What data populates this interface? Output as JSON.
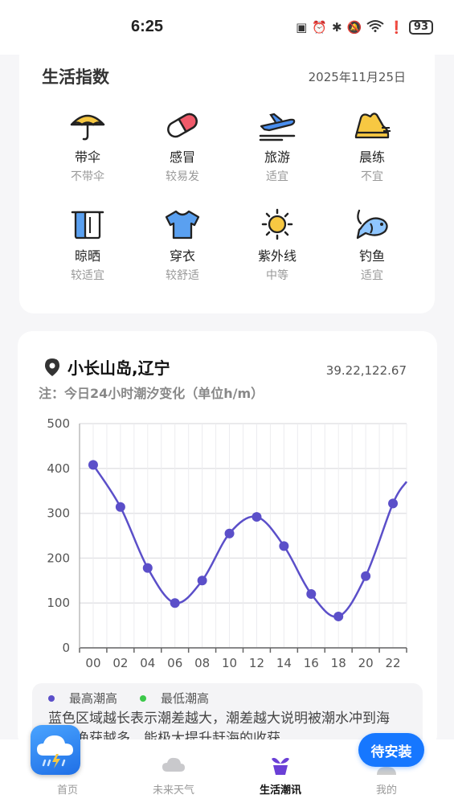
{
  "status_bar": {
    "time": "6:25",
    "battery": "93",
    "icons": [
      "nfc-icon",
      "alarm-icon",
      "bluetooth-icon",
      "mute-icon",
      "wifi-icon",
      "alert-icon",
      "battery-icon"
    ]
  },
  "life_index": {
    "title": "生活指数",
    "date": "2025年11月25日",
    "items": [
      {
        "icon": "umbrella-icon",
        "name": "带伞",
        "value": "不带伞"
      },
      {
        "icon": "pill-icon",
        "name": "感冒",
        "value": "较易发"
      },
      {
        "icon": "airplane-icon",
        "name": "旅游",
        "value": "适宜"
      },
      {
        "icon": "shoe-icon",
        "name": "晨练",
        "value": "不宜"
      },
      {
        "icon": "towel-icon",
        "name": "晾晒",
        "value": "较适宜"
      },
      {
        "icon": "tshirt-icon",
        "name": "穿衣",
        "value": "较舒适"
      },
      {
        "icon": "sun-icon",
        "name": "紫外线",
        "value": "中等"
      },
      {
        "icon": "fish-icon",
        "name": "钓鱼",
        "value": "适宜"
      }
    ]
  },
  "tide": {
    "location": "小长山岛,辽宁",
    "coords": "39.22,122.67",
    "note": "注：今日24小时潮汐变化（单位h/m）",
    "legend": [
      {
        "label": "最高潮高",
        "color": "#5b4fc9"
      },
      {
        "label": "最低潮高",
        "color": "#3cc84a"
      }
    ],
    "description": "蓝色区域越长表示潮差越大，潮差越大说明被潮水冲到海岸的渔获越多，能极大提升赶海的收获"
  },
  "chart_data": {
    "type": "line",
    "x": [
      1,
      3,
      5,
      7,
      9,
      11,
      13,
      15,
      17,
      19,
      21,
      23
    ],
    "x_ticks": [
      "00",
      "02",
      "04",
      "06",
      "08",
      "10",
      "12",
      "14",
      "16",
      "18",
      "20",
      "22"
    ],
    "series": [
      {
        "values": [
          408,
          314,
          178,
          100,
          150,
          255,
          292,
          227,
          120,
          70,
          160,
          322
        ],
        "color": "#5b4fc9"
      }
    ],
    "y_ticks": [
      0,
      100,
      200,
      300,
      400,
      500
    ],
    "ylim": [
      0,
      500
    ],
    "xlim": [
      0,
      24
    ],
    "grid": true
  },
  "tab_bar": {
    "tabs": [
      {
        "icon": "home-icon",
        "label": "首页"
      },
      {
        "icon": "cloud-icon",
        "label": "未来天气"
      },
      {
        "icon": "plant-icon",
        "label": "生活潮讯"
      },
      {
        "icon": "user-icon",
        "label": "我的"
      }
    ],
    "active": 2
  },
  "overlay": {
    "app_icon": "weather-app-icon",
    "install_button": "待安装"
  }
}
